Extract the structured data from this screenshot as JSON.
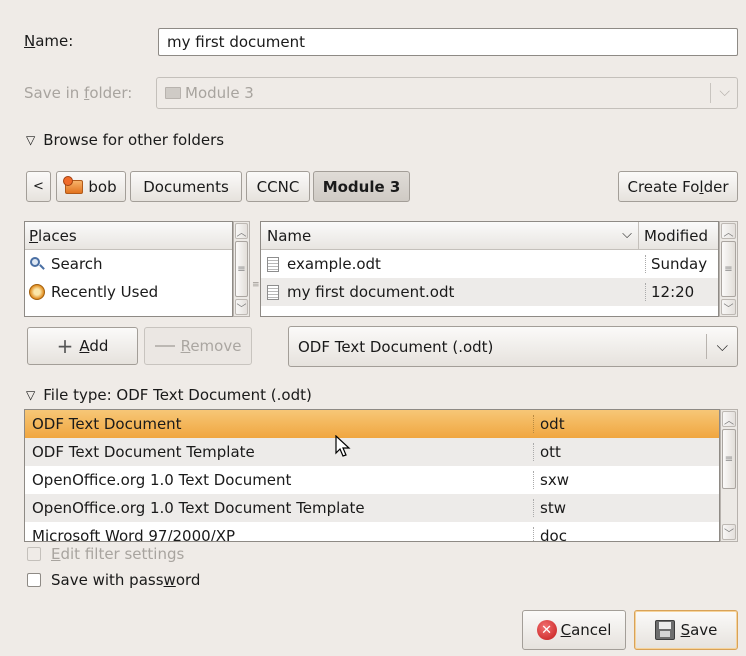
{
  "name": {
    "label": "Name:",
    "value": "my first document"
  },
  "save_in": {
    "label": "Save in folder:",
    "value": "Module 3"
  },
  "browse_toggle": "Browse for other folders",
  "path_bar": {
    "back_arrow": "<",
    "buttons": [
      "bob",
      "Documents",
      "CCNC",
      "Module 3"
    ],
    "active": "Module 3"
  },
  "create_folder": "Create Folder",
  "places": {
    "header": "Places",
    "items": [
      {
        "label": "Search",
        "icon": "search-icon"
      },
      {
        "label": "Recently Used",
        "icon": "recent-icon"
      }
    ]
  },
  "files": {
    "col_name": "Name",
    "col_modified": "Modified",
    "rows": [
      {
        "name": "example.odt",
        "modified": "Sunday"
      },
      {
        "name": "my first document.odt",
        "modified": "12:20"
      }
    ]
  },
  "add_button": "Add",
  "remove_button": "Remove",
  "filter_select": "ODF Text Document (.odt)",
  "file_type": {
    "expander": "File type: ODF Text Document (.odt)",
    "rows": [
      {
        "name": "ODF Text Document",
        "ext": "odt"
      },
      {
        "name": "ODF Text Document Template",
        "ext": "ott"
      },
      {
        "name": "OpenOffice.org 1.0 Text Document",
        "ext": "sxw"
      },
      {
        "name": "OpenOffice.org 1.0 Text Document Template",
        "ext": "stw"
      },
      {
        "name": "Microsoft Word 97/2000/XP",
        "ext": "doc"
      }
    ]
  },
  "edit_filter": "Edit filter settings",
  "save_password": "Save with password",
  "cancel_button": "Cancel",
  "save_button": "Save",
  "colors": {
    "selection": "#f0a640",
    "window_bg": "#efebe7"
  }
}
